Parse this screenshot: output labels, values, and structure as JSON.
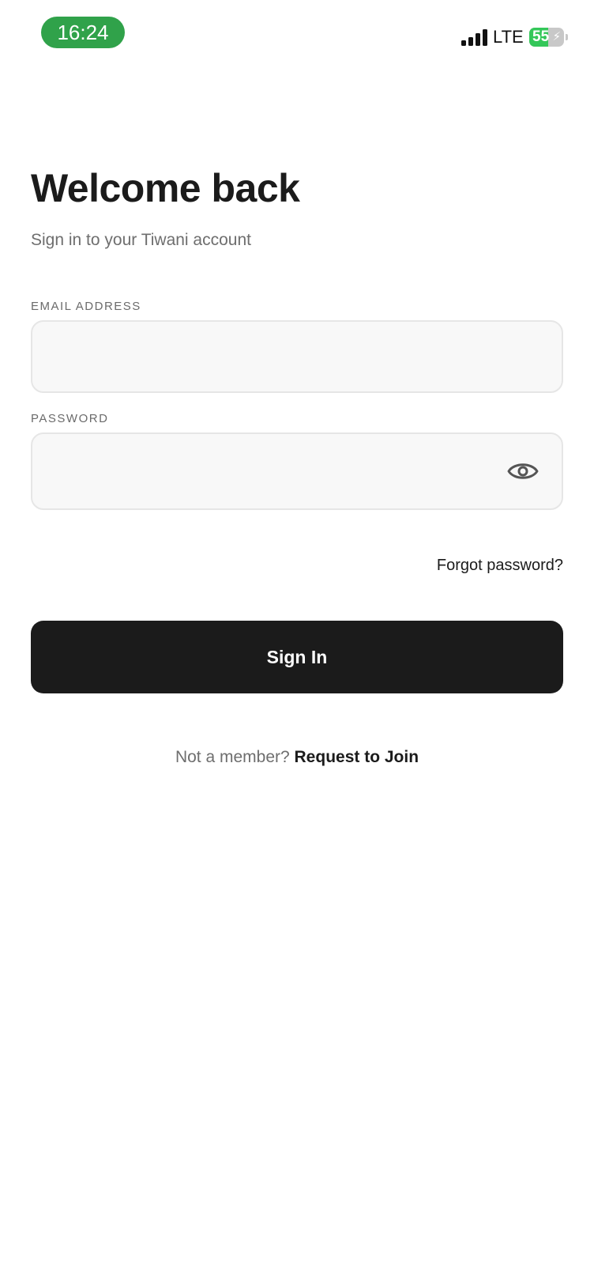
{
  "status_bar": {
    "time": "16:24",
    "network": "LTE",
    "battery_level": "55",
    "battery_fraction": 0.55,
    "charging": true,
    "time_pill_color": "#30a24a",
    "battery_color": "#34c759"
  },
  "header": {
    "title": "Welcome back",
    "subtitle": "Sign in to your Tiwani account"
  },
  "form": {
    "email": {
      "label": "EMAIL ADDRESS",
      "value": "",
      "placeholder": ""
    },
    "password": {
      "label": "PASSWORD",
      "value": "",
      "placeholder": "",
      "toggle_icon": "eye-icon"
    },
    "forgot_label": "Forgot password?",
    "submit_label": "Sign In"
  },
  "footer": {
    "prompt": "Not a member?",
    "link_label": "Request to Join"
  },
  "colors": {
    "primary_button": "#1b1b1b",
    "input_background": "#f8f8f8",
    "input_border": "#e6e6e6",
    "muted_text": "#6e6e6e"
  }
}
